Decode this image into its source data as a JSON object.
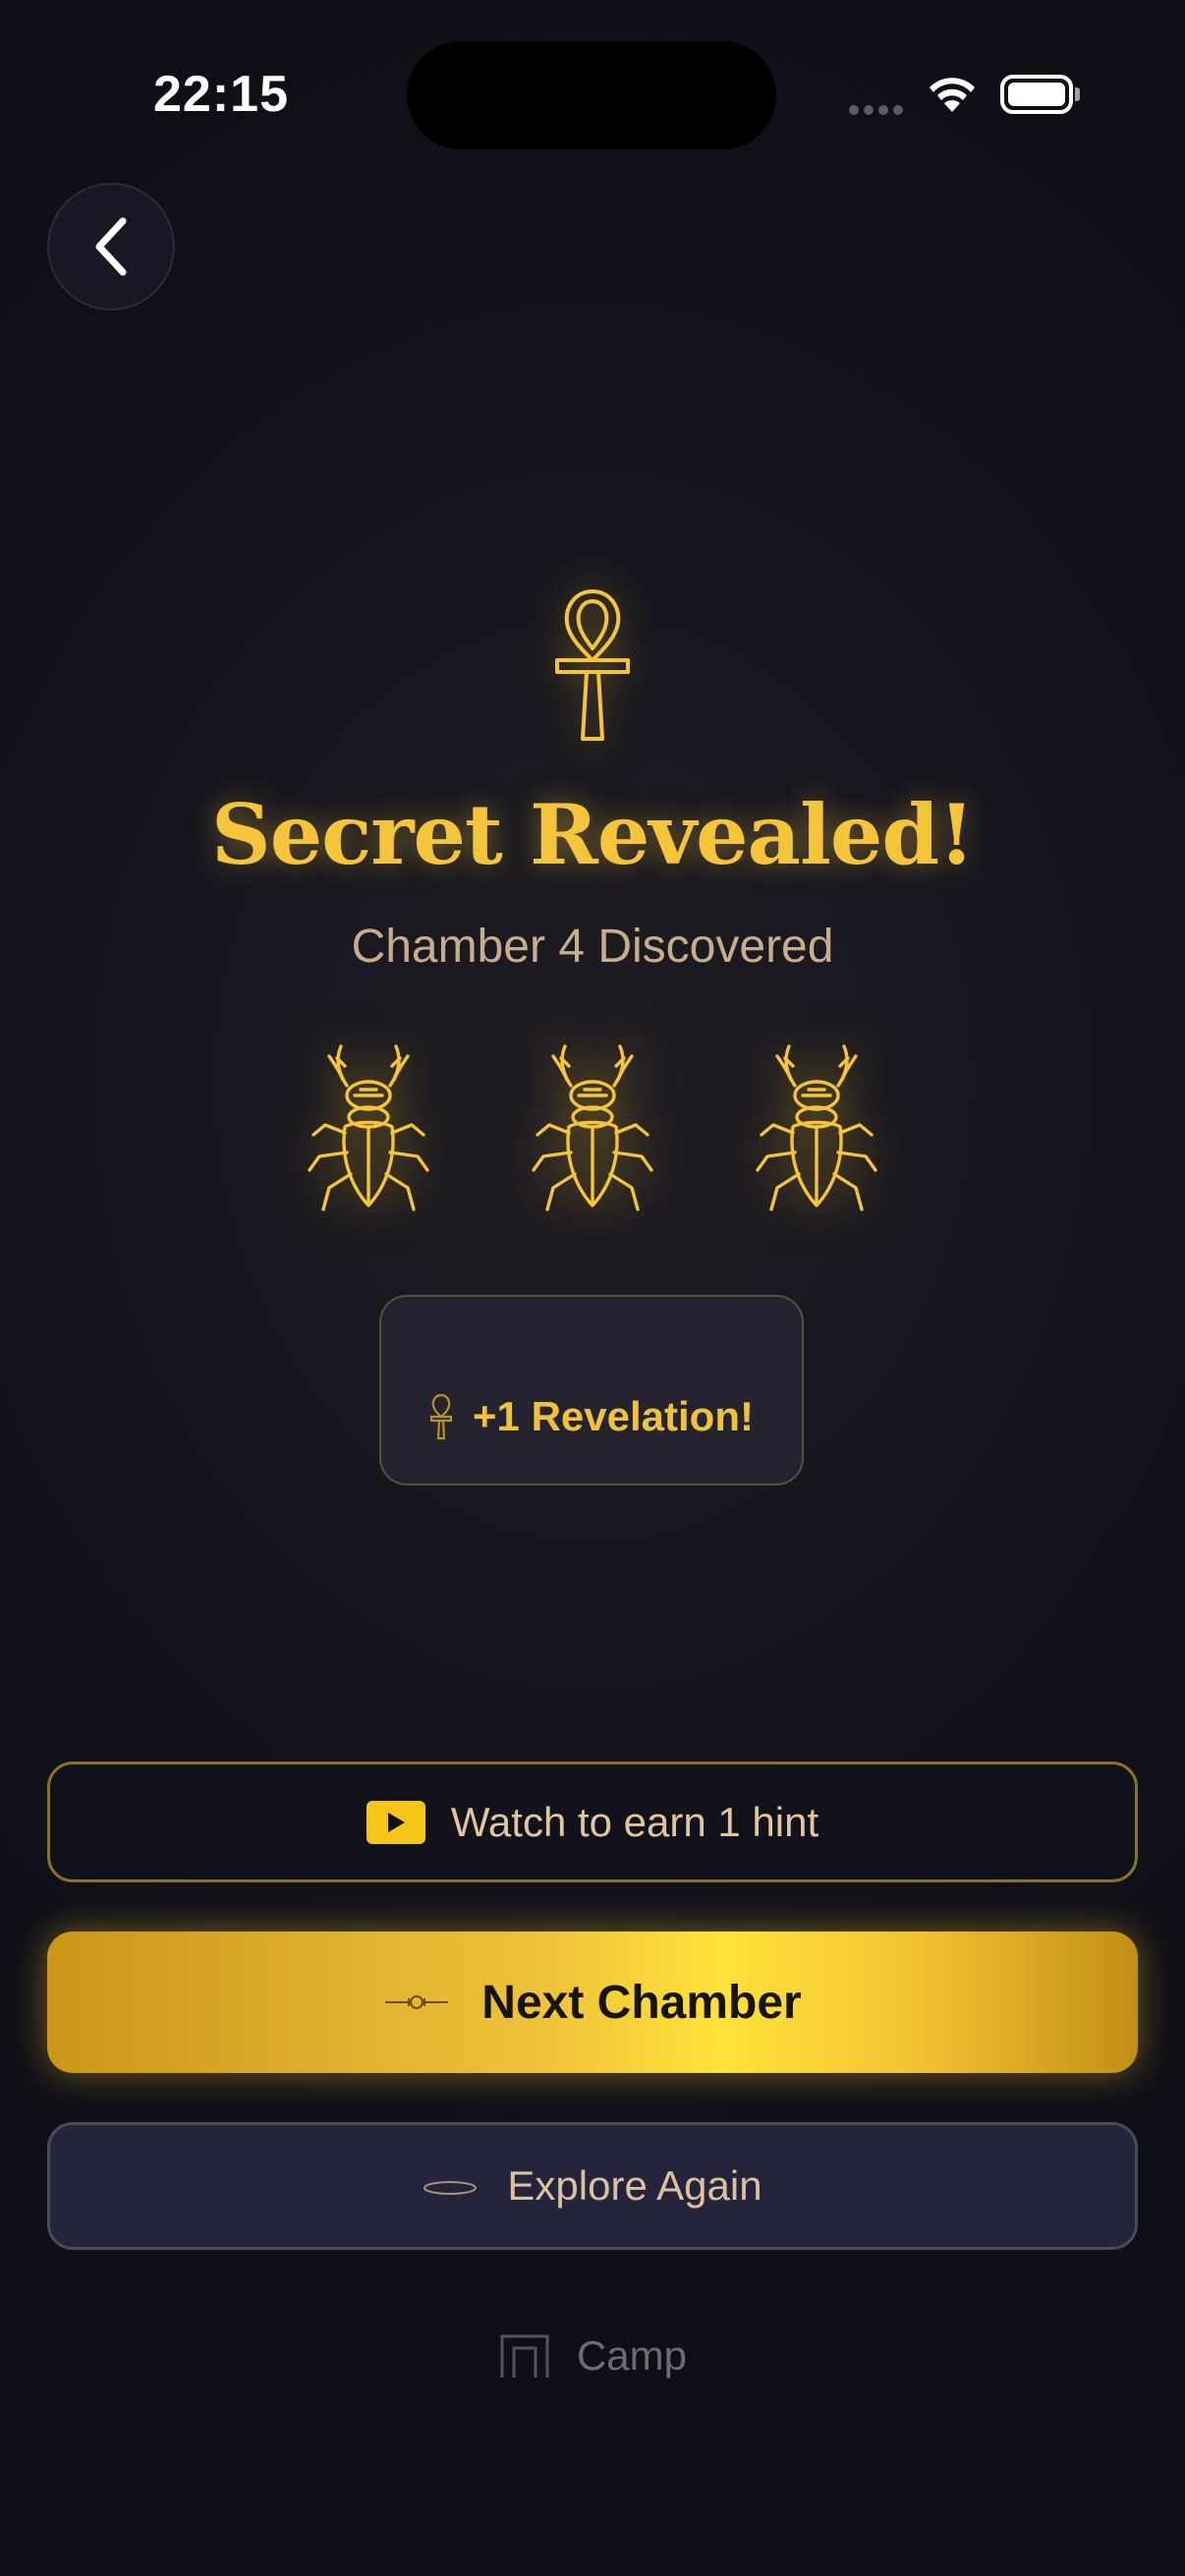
{
  "status_bar": {
    "time": "22:15"
  },
  "hero": {
    "title": "Secret Revealed!",
    "subtitle": "Chamber 4 Discovered",
    "scarab_count": 3
  },
  "reward": {
    "label": "+1 Revelation!"
  },
  "actions": {
    "watch_label": "Watch to earn 1 hint",
    "next_label": "Next Chamber",
    "explore_label": "Explore Again",
    "camp_label": "Camp"
  },
  "colors": {
    "gold": "#f4c43a",
    "subtitle": "#c8ad8c",
    "background": "#121220"
  },
  "icons": [
    "chevron-left-icon",
    "ankh-icon",
    "scarab-icon",
    "play-icon",
    "sword-icon",
    "disc-icon",
    "camp-icon",
    "wifi-icon",
    "battery-icon"
  ]
}
